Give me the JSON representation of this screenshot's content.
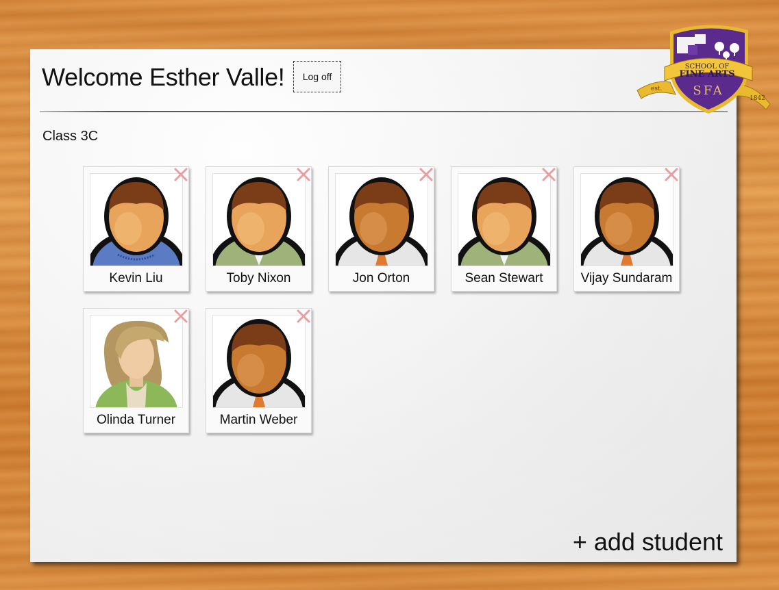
{
  "header": {
    "welcome": "Welcome Esther Valle!",
    "logoff_label": "Log off"
  },
  "crest": {
    "line1": "SCHOOL OF",
    "line2": "FINE ARTS",
    "initials": "SFA",
    "est_label": "est.",
    "year": "1842",
    "colors": {
      "shield": "#5a2a8c",
      "banner": "#f2c53a"
    }
  },
  "class_name": "Class 3C",
  "students": [
    {
      "name": "Kevin Liu",
      "avatar": "male-sweater-icon"
    },
    {
      "name": "Toby Nixon",
      "avatar": "male-green-shirt-icon"
    },
    {
      "name": "Jon Orton",
      "avatar": "male-tie-icon"
    },
    {
      "name": "Sean Stewart",
      "avatar": "male-green-shirt-icon"
    },
    {
      "name": "Vijay Sundaram",
      "avatar": "male-tie-icon"
    },
    {
      "name": "Olinda Turner",
      "avatar": "female-icon"
    },
    {
      "name": "Martin Weber",
      "avatar": "male-tie-icon"
    }
  ],
  "add_student_label": "+ add student"
}
